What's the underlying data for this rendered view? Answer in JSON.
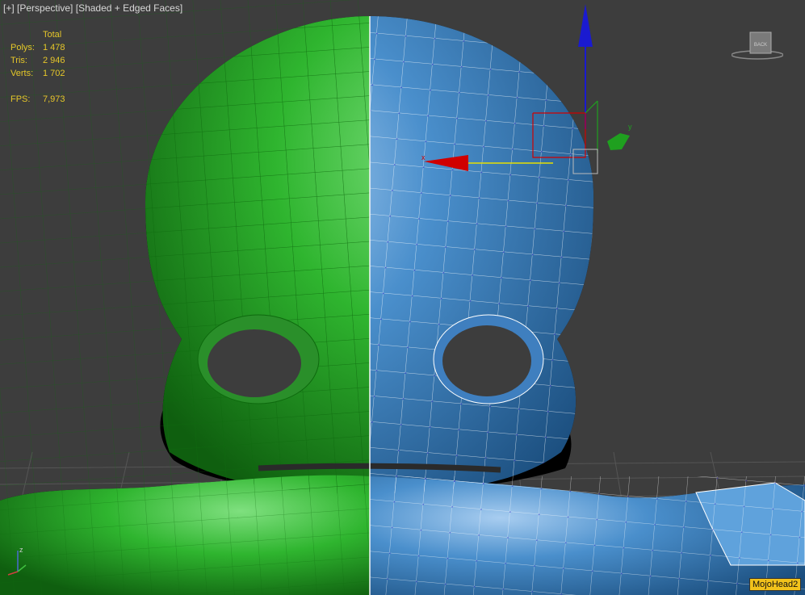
{
  "viewport": {
    "label_menu": "[+]",
    "label_view": "[Perspective]",
    "label_shading": "[Shaded + Edged Faces]"
  },
  "stats": {
    "column_header": "Total",
    "polys_label": "Polys:",
    "polys_value": "1 478",
    "tris_label": "Tris:",
    "tris_value": "2 946",
    "verts_label": "Verts:",
    "verts_value": "1 702",
    "fps_label": "FPS:",
    "fps_value": "7,973"
  },
  "viewcube": {
    "face_label": "BACK"
  },
  "gizmo": {
    "x_label": "x",
    "y_label": "y"
  },
  "axis_tripod": {
    "z_label": "z"
  },
  "object_name": "MojoHead2",
  "colors": {
    "background": "#3d3d3d",
    "stats_text": "#e6c62a",
    "green_mesh": "#2fb52f",
    "blue_mesh": "#3f86c6",
    "gizmo_x": "#d00000",
    "gizmo_y": "#1fa01f",
    "gizmo_z": "#1a1ad0",
    "label_bg": "#f2c21b"
  },
  "icons": [
    "viewcube-icon",
    "move-gizmo-icon",
    "axis-tripod-icon"
  ]
}
